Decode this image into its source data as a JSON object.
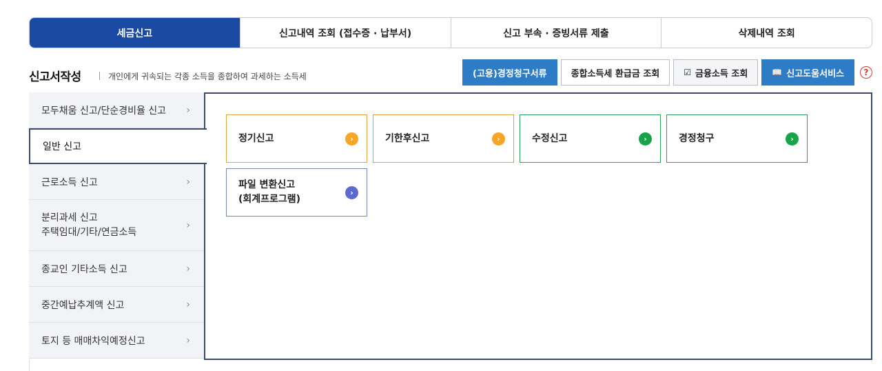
{
  "tabs": [
    {
      "label": "세금신고"
    },
    {
      "label": "신고내역 조회 (접수증 · 납부서)"
    },
    {
      "label": "신고 부속 · 증빙서류 제출"
    },
    {
      "label": "삭제내역 조회"
    }
  ],
  "section": {
    "title": "신고서작성",
    "description": "개인에게 귀속되는 각종 소득을 종합하여 과세하는 소득세"
  },
  "header_buttons": {
    "correction_docs": "(고용)경정청구서류",
    "refund_inquiry": "종합소득세 환급금 조회",
    "financial_income": "금융소득 조회",
    "help_service": "신고도움서비스",
    "help_icon": "?"
  },
  "side_menu": [
    {
      "label": "모두채움 신고/단순경비율 신고"
    },
    {
      "label": "일반 신고"
    },
    {
      "label": "근로소득 신고"
    },
    {
      "label": "분리과세 신고\n주택임대/기타/연금소득"
    },
    {
      "label": "종교인 기타소득 신고"
    },
    {
      "label": "중간예납추계액 신고"
    },
    {
      "label": "토지 등 매매차익예정신고"
    }
  ],
  "cards": [
    {
      "label": "정기신고",
      "color": "#f5a623"
    },
    {
      "label": "기한후신고",
      "color": "#f5a623"
    },
    {
      "label": "수정신고",
      "color": "#17a34a"
    },
    {
      "label": "경정청구",
      "color": "#17a34a"
    },
    {
      "label": "파일 변환신고\n(회계프로그램)",
      "color": "#5b6ad0"
    }
  ],
  "colors": {
    "active_tab": "#1b4aa3",
    "button_blue": "#2f7cc6",
    "panel_border": "#3b4a6b"
  }
}
